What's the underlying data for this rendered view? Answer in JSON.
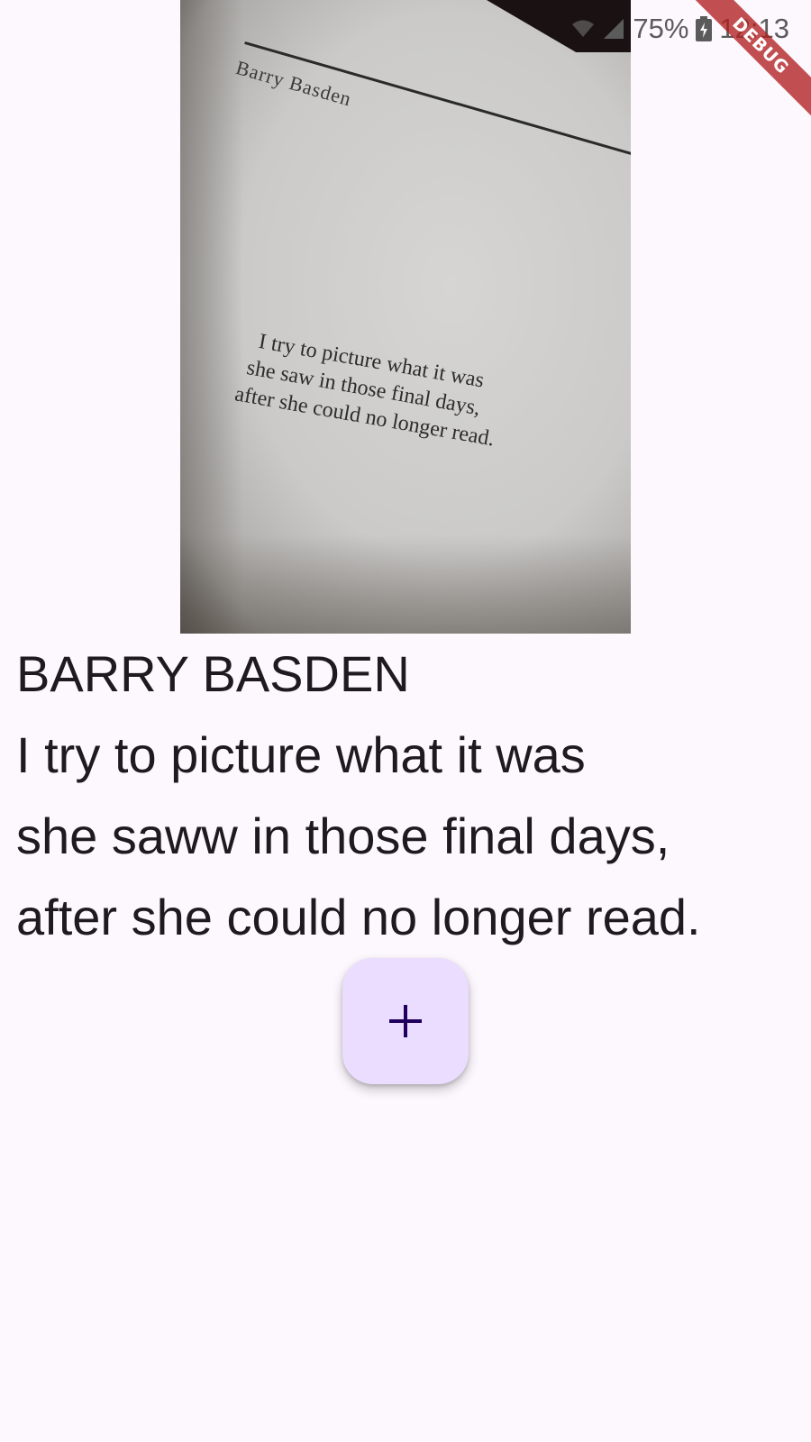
{
  "status_bar": {
    "battery_percent": "75%",
    "time": "12:13",
    "icons": [
      "wifi-icon",
      "signal-icon",
      "battery-charging-icon"
    ]
  },
  "debug_banner": "DEBUG",
  "photo": {
    "page_header": "Barry Basden",
    "page_lines": [
      "I try to picture what it was",
      "she saw in those final days,",
      "after she could no longer read."
    ]
  },
  "recognized_text": {
    "lines": [
      "BARRY BASDEN",
      "I try to picture what it was",
      "she saww in those final days,",
      "after she could no longer read."
    ]
  },
  "fab": {
    "icon": "plus-icon"
  },
  "colors": {
    "background": "#fdf7fe",
    "fab_background": "#eaddff",
    "fab_icon": "#21005d",
    "text": "#1d1b20"
  }
}
